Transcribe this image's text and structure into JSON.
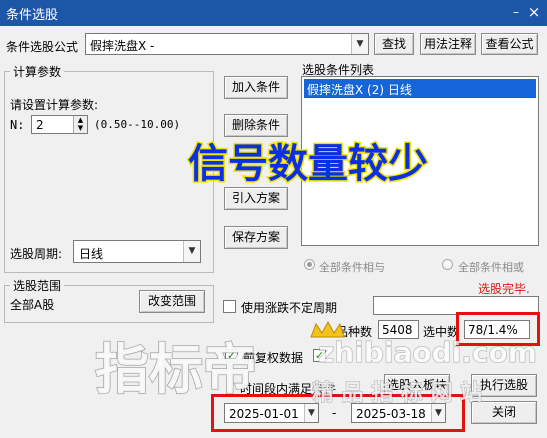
{
  "window": {
    "title": "条件选股",
    "min": "–",
    "close": "×"
  },
  "formula": {
    "label": "条件选股公式",
    "value": "假摔洗盘X  -",
    "find": "查找",
    "usage": "用法注释",
    "view": "查看公式"
  },
  "params": {
    "group": "计算参数",
    "prompt": "请设置计算参数:",
    "n_label": "N:",
    "n_value": "2",
    "range": "(0.50--10.00)",
    "period_label": "选股周期:",
    "period_value": "日线"
  },
  "actions": {
    "add": "加入条件",
    "delete": "删除条件",
    "import": "引入方案",
    "save": "保存方案"
  },
  "conditions": {
    "title": "选股条件列表",
    "items": [
      "假摔洗盘X (2) 日线"
    ],
    "all_and": "全部条件相与",
    "all_or": "全部条件相或",
    "status": "选股完毕."
  },
  "scope": {
    "group": "选股范围",
    "value": "全部A股",
    "change": "改变范围"
  },
  "options": {
    "use_limit": "使用涨跌不定周期",
    "fq": "前复权数据",
    "save_result": "选股入板块",
    "run": "执行选股",
    "close": "关闭",
    "time_label": "时间段内满足条件"
  },
  "stats": {
    "count_label": "品种数",
    "count_value": "5408",
    "sel_label": "选中数",
    "sel_value": "78/1.4%"
  },
  "dates": {
    "start": "2025-01-01",
    "sep": "-",
    "end": "2025-03-18"
  },
  "overlay": {
    "banner": "信号数量较少",
    "watermark_big": "指标帝",
    "watermark_url": "zhibiaodi.com",
    "watermark_sub": "精 品 指 标 网 站"
  },
  "colors": {
    "title_bar": "#1d55a8",
    "select": "#1565d8",
    "banner_fill": "#0b2fe6",
    "banner_stroke": "#f2e300",
    "status": "#e01818",
    "highlight": "#e61010"
  }
}
